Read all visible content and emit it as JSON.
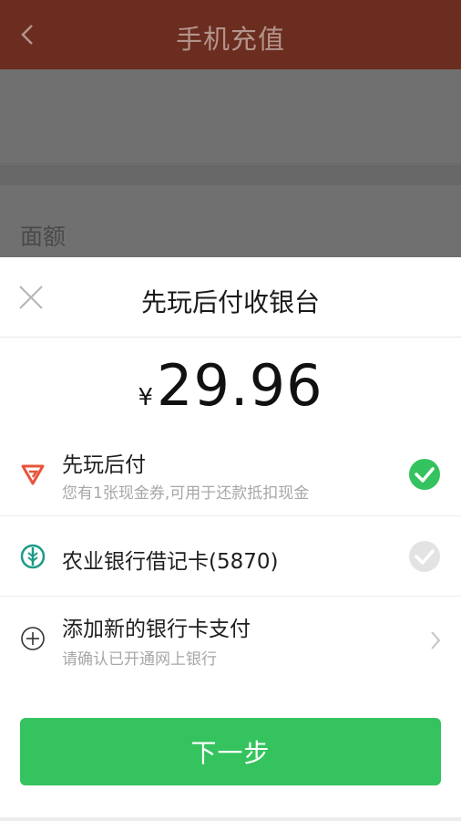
{
  "background_page": {
    "title": "手机充值",
    "field_label": "面额"
  },
  "sheet": {
    "title": "先玩后付收银台",
    "currency": "¥",
    "amount": "29.96",
    "options": [
      {
        "label": "先玩后付",
        "sub": "您有1张现金券,可用于还款抵扣现金",
        "selected": true
      },
      {
        "label": "农业银行借记卡(5870)",
        "selected": false
      },
      {
        "label": "添加新的银行卡支付",
        "sub": "请确认已开通网上银行"
      }
    ],
    "next_button": "下一步"
  },
  "colors": {
    "topbar": "#6b2d1f",
    "accent_green": "#34c35e",
    "overlay": "#6e6e6e"
  },
  "icons": [
    "back-icon",
    "clear-icon",
    "close-icon",
    "xianwanhoufu-logo-icon",
    "abc-bank-logo-icon",
    "add-circle-icon",
    "check-circle-icon",
    "chevron-right-icon"
  ]
}
